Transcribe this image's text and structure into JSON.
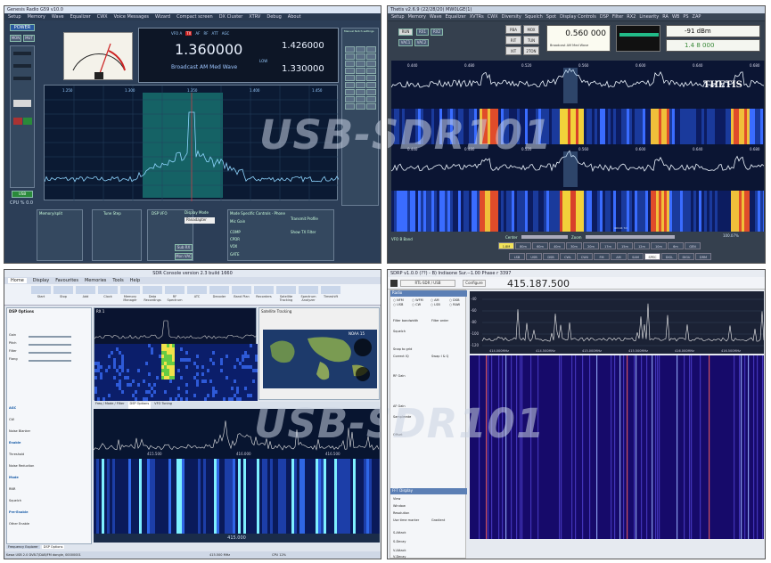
{
  "watermark": "USB-SDR101",
  "genesis": {
    "title": "Genesis Radio G59 v10.0",
    "menu": [
      "Setup",
      "Memory",
      "Wave",
      "Equalizer",
      "CWX",
      "Voice Messages",
      "Wizard",
      "Compact screen",
      "DX Cluster",
      "XTRV",
      "Debug",
      "About"
    ],
    "power_label": "POWER",
    "mode_labels": [
      "MON",
      "MUT"
    ],
    "vfo_a_freq": "1.360000",
    "band_name": "Broadcast AM Med Wave",
    "sub_freq_top": "1.426000",
    "sub_freq_bottom": "1.330000",
    "low_label": "LOW",
    "vfo_tags": [
      "VFO A",
      "TX",
      "AF",
      "RF",
      "ATT",
      "AGC"
    ],
    "freq_ticks": [
      "1.250",
      "1.300",
      "1.350",
      "1.400",
      "1.450"
    ],
    "status_bar": "CPU % 0.0",
    "usb_label": "USB",
    "sub_rx_label": "Sub RX",
    "mon_vac_label": "Mon VAC",
    "mode_specific_title": "Mode Specific Controls - Phone",
    "tx_profile_label": "Transmit Profile",
    "mic_gain_label": "Mic Gain",
    "comp_label": "COMP",
    "cpdr_label": "CPDR",
    "vox_label": "VOX",
    "gate_label": "GATE",
    "display_mode_label": "Display Mode",
    "display_mode_value": "Panadapter",
    "show_tx_filter": "Show TX Filter",
    "tune_step_label": "Tune Step",
    "dsp_vfo_label": "DSP VFO",
    "manual_notch_label": "Manual Notch settings",
    "memory_label": "Memory/split",
    "filter_label": "Filter"
  },
  "thetis": {
    "title": "Thetis v2.6.9 (22/28/20) MW0LGE(1)",
    "menu": [
      "Setup",
      "Memory",
      "Wave",
      "Equalizer",
      "XVTRs",
      "CWX",
      "Diversity",
      "Squelch",
      "Spot",
      "Display Controls",
      "DSP",
      "Filter",
      "RX2",
      "Linearity",
      "RA",
      "WB",
      "PS",
      "ZAP"
    ],
    "logo": "THETIS",
    "vfo_main": "0.560 000",
    "vfo_label": "Broadcast AM Med Wave",
    "vfo_b": "1.4 8 000",
    "meter_readout": "-91 dBm",
    "run_label": "RUN",
    "rx1_label": "RX1",
    "rx2_label": "RX2",
    "vac_labels": [
      "VAC1",
      "VAC2"
    ],
    "buttons": [
      "PBA",
      "MOX",
      "RIT",
      "TUN",
      "XIT",
      "2TON"
    ],
    "freq_ticks": [
      "0.440",
      "0.480",
      "0.520",
      "0.560",
      "0.600",
      "0.640",
      "0.680"
    ],
    "center_label": "Center",
    "zoom_label": "Zoom",
    "vfo_band_label": "VFO B Band",
    "bands": [
      "1.8M",
      "80m",
      "60m",
      "40m",
      "30m",
      "20m",
      "17m",
      "15m",
      "12m",
      "10m",
      "6m",
      "GEN"
    ],
    "modes": [
      "LSB",
      "USB",
      "DSB",
      "CWL",
      "CWU",
      "FM",
      "AM",
      "SAM",
      "SPEC",
      "DIGL",
      "DIGU",
      "DRM"
    ],
    "timestamp": "40104 7m",
    "cpu": "100.07%"
  },
  "sdr": {
    "title": "SDR Console version 2.3 build 1660",
    "tabs": [
      "Home",
      "Display",
      "Favourites",
      "Memories",
      "Tools",
      "Help"
    ],
    "ribbon": [
      "Start",
      "Stop",
      "Add",
      "Clock",
      "Memory Manager",
      "Data Recordings",
      "RF Spectrum",
      "ATC",
      "Decoder",
      "Band Plan",
      "Recorders",
      "Satellite Tracking",
      "Spectrum Analyzer",
      "Timeshift"
    ],
    "dsp_title": "DSP Options",
    "controls": [
      "Gain",
      "Pitch",
      "Filter",
      "Flang"
    ],
    "sections": [
      "AGC",
      "CW",
      "Noise Blanker",
      "Enable",
      "Threshold",
      "Noise Reduction",
      "Mode",
      "RNR",
      "Squelch",
      "Pre-Enable",
      "Other Enable"
    ],
    "rx_tab": "RX 1",
    "freq_ticks": [
      "415.500",
      "416.000",
      "416.500"
    ],
    "satellite_title": "Satellite Tracking",
    "satellite_caption": "NOAA 15",
    "bottom_freq": "415.000",
    "status": "Kawa USB 2.0 DVB-T/DAB/FM dongle, 00000001",
    "dsp_tabs": [
      "Frequency Explorer",
      "DSP Options"
    ],
    "panel_tabs": [
      "Freq / Mode / Filter",
      "DSP Options",
      "VFO Tuning"
    ],
    "cpu": "CPU 12%",
    "rx_freq_readout": "415.500 MHz"
  },
  "sdrpp": {
    "title": "SDRP v1.0.0 (??) - B) Indiaone Sur.--1.00 Phase r 3397",
    "source_label": "RTL-SDR / USB",
    "vfo_freq": "415.187.500",
    "configure": "Configure",
    "radio_title": "Radio",
    "modes": [
      "NFM",
      "WFM",
      "AM",
      "DSB",
      "USB",
      "CW",
      "LSB",
      "RAW"
    ],
    "filter_label": "Filter bandwidth",
    "filter_order": "Filter order",
    "squelch_label": "Squelch",
    "snap_label": "Snap to grid",
    "correct_label": "Correct IQ",
    "swap_label": "Swap I & Q",
    "rf_gain": "RF Gain",
    "af_gain_label": "AF Gain",
    "samplerate": "Samplerate",
    "offset": "Offset",
    "fft_title": "FFT Display",
    "view_label": "View",
    "window_label": "Window",
    "resolution_label": "Resolution",
    "freq_ticks": [
      "414.000MHz",
      "414.500MHz",
      "415.000MHz",
      "415.500MHz",
      "416.000MHz",
      "416.500MHz"
    ],
    "db_ticks": [
      "-40",
      "-60",
      "-80",
      "-100",
      "-120"
    ],
    "use_time_label": "Use time marker",
    "gradient_label": "Gradient",
    "s_attack": "S-Attack",
    "s_decay": "S-Decay",
    "v_attack": "V-Attack",
    "v_decay": "V-Decay"
  },
  "colors": {
    "spectrum_bg": "#0b1a33",
    "trace": "#e8f2ff",
    "passband": "#1f9e8e",
    "accent_red": "#d0302a"
  }
}
